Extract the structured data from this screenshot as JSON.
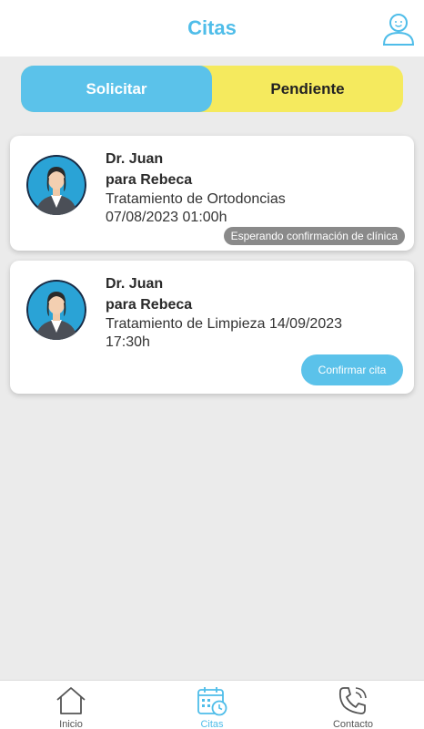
{
  "header": {
    "title": "Citas",
    "profile_icon": "user-icon"
  },
  "tabs": {
    "solicitar": "Solicitar",
    "pendiente": "Pendiente"
  },
  "appointments": [
    {
      "doctor": "Dr. Juan",
      "patient": "para Rebeca",
      "treatment": "Tratamiento de Ortodoncias",
      "datetime": "07/08/2023 01:00h",
      "status": "Esperando confirmación de clínica"
    },
    {
      "doctor": "Dr. Juan",
      "patient": "para Rebeca",
      "treatment": "Tratamiento de Limpieza 14/09/2023",
      "datetime": "17:30h",
      "action": "Confirmar cita"
    }
  ],
  "bottom_nav": {
    "items": [
      {
        "label": "Inicio",
        "icon": "home-icon"
      },
      {
        "label": "Citas",
        "icon": "calendar-clock-icon",
        "active": true
      },
      {
        "label": "Contacto",
        "icon": "phone-icon"
      }
    ]
  },
  "colors": {
    "accent": "#5bc2ea",
    "pending_tab": "#f5ea5e",
    "background": "#ebebeb",
    "status_badge": "#8a8a8a"
  }
}
